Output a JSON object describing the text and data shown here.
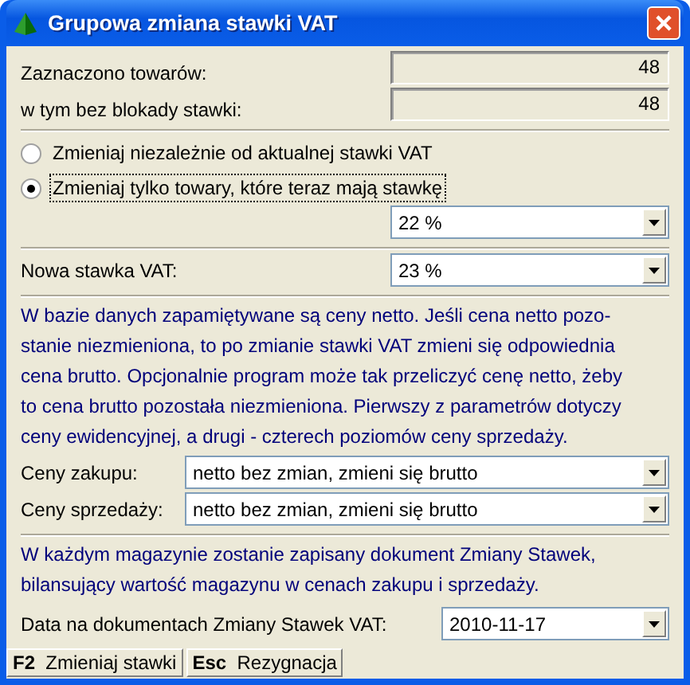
{
  "window": {
    "title": "Grupowa zmiana stawki VAT"
  },
  "counts": [
    {
      "label": "Zaznaczono towarów:",
      "value": "48"
    },
    {
      "label": "w tym bez blokady stawki:",
      "value": "48"
    }
  ],
  "mode_options": [
    {
      "label": "Zmieniaj niezależnie od aktualnej stawki VAT",
      "selected": false
    },
    {
      "label": "Zmieniaj tylko towary, które teraz mają stawkę",
      "selected": true
    }
  ],
  "current_rate": {
    "value": "22 %"
  },
  "new_rate": {
    "label": "Nowa stawka VAT:",
    "value": "23 %"
  },
  "info_1": "W bazie danych zapamiętywane są ceny netto. Jeśli cena netto pozo-\nstanie niezmieniona, to po zmianie stawki VAT zmieni się odpowiednia\ncena brutto. Opcjonalnie program może tak przeliczyć cenę netto, żeby\nto cena brutto pozostała niezmieniona. Pierwszy z parametrów dotyczy\nceny ewidencyjnej, a drugi - czterech poziomów ceny sprzedaży.",
  "price_options": [
    {
      "label": "Ceny zakupu:",
      "value": "netto bez zmian, zmieni się brutto"
    },
    {
      "label": "Ceny sprzedaży:",
      "value": "netto bez zmian, zmieni się brutto"
    }
  ],
  "info_2": "W każdym magazynie zostanie zapisany dokument Zmiany Stawek,\nbilansujący wartość magazynu w cenach zakupu i sprzedaży.",
  "document_date": {
    "label": "Data na dokumentach Zmiany Stawek VAT:",
    "value": "2010-11-17"
  },
  "buttons": [
    {
      "key": "F2",
      "label": "Zmieniaj stawki"
    },
    {
      "key": "Esc",
      "label": "Rezygnacja"
    }
  ]
}
